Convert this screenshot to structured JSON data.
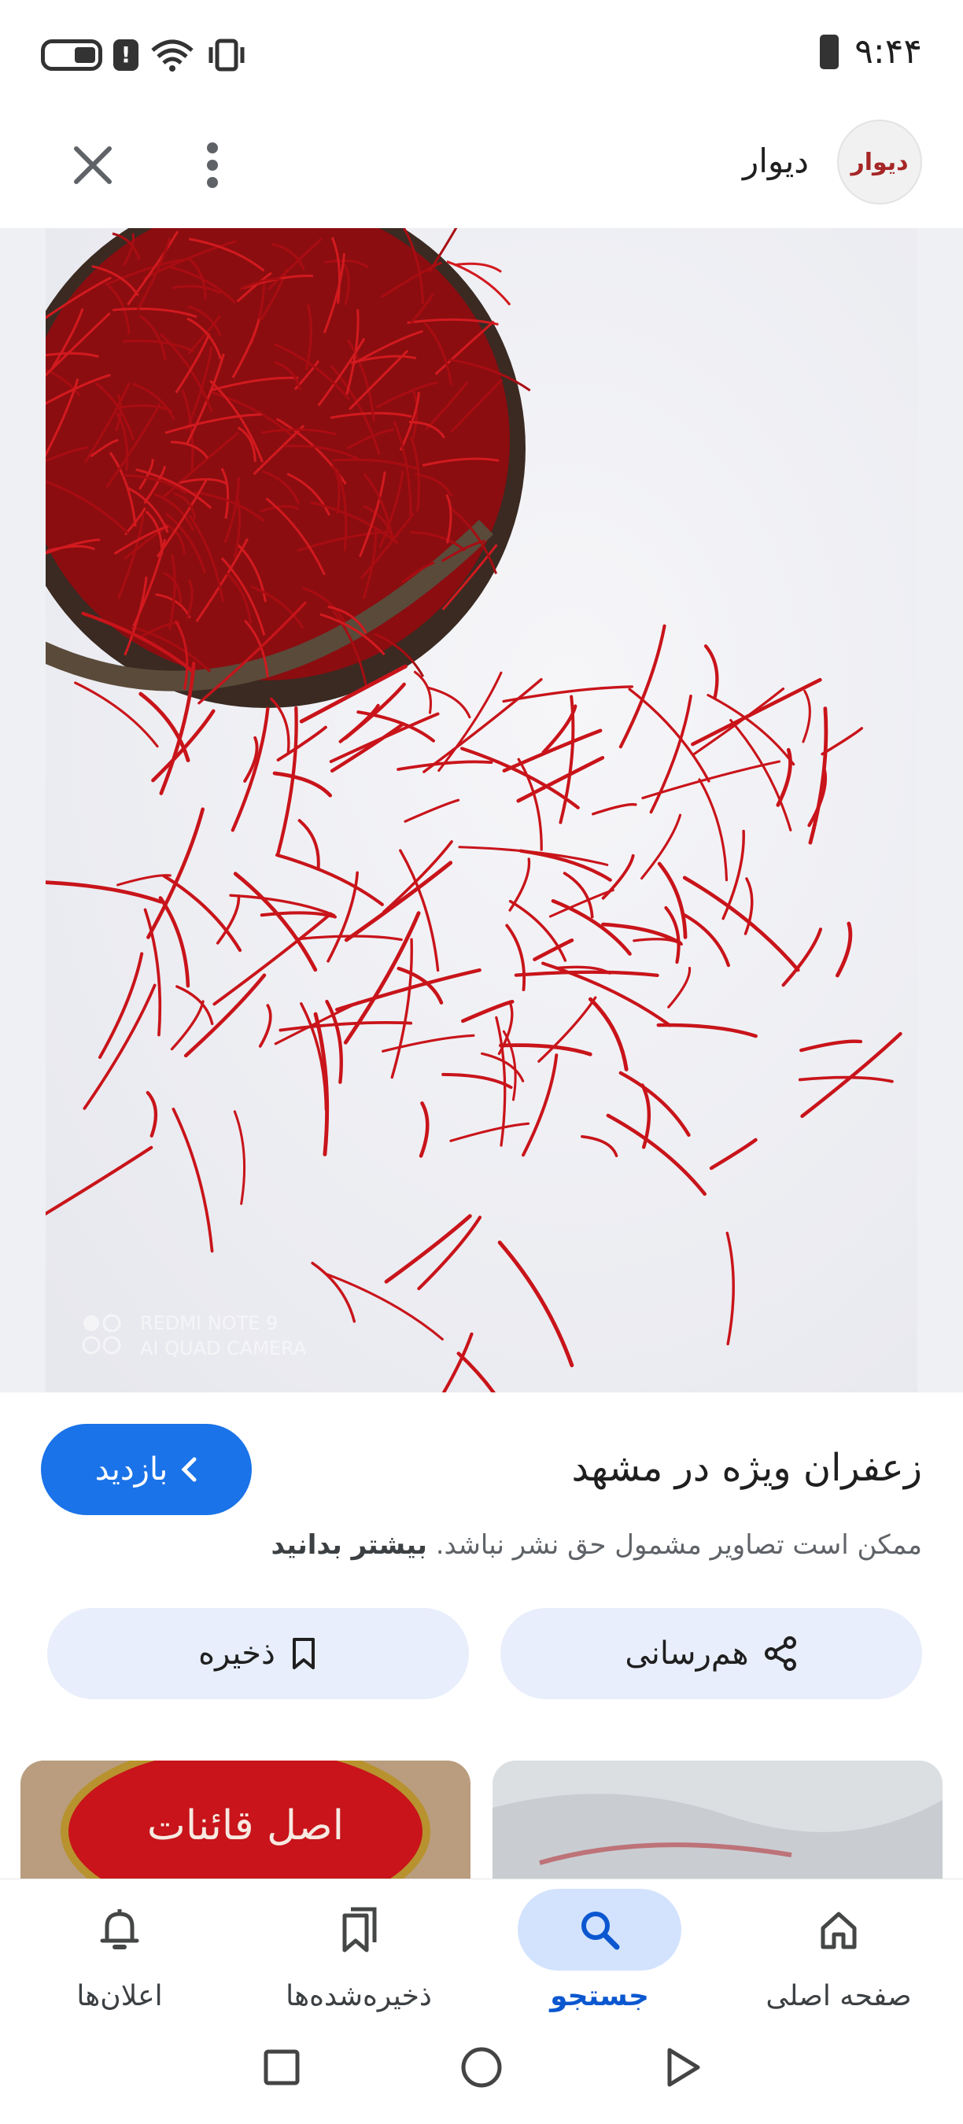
{
  "status_bar": {
    "time": "۹:۴۴",
    "icons": [
      "battery-saver-icon",
      "alert-icon",
      "wifi-icon",
      "vibrate-icon",
      "battery-icon"
    ]
  },
  "app_bar": {
    "site_name": "دیوار",
    "logo_text": "دیوار",
    "icons": [
      "close-icon",
      "more-vert-icon"
    ]
  },
  "image": {
    "watermark_line1": "REDMI NOTE 9",
    "watermark_line2": "AI QUAD CAMERA"
  },
  "info": {
    "title": "زعفران ویژه در مشهد",
    "visit_label": "بازدید",
    "disclaimer": "ممکن است تصاویر مشمول حق نشر نباشد.",
    "learn_more": "بیشتر بدانید",
    "share_label": "هم‌رسانی",
    "save_label": "ذخیره"
  },
  "thumbnails": [
    {
      "label_text": "اصل قائنات"
    },
    {
      "label_text": ""
    }
  ],
  "bottom_nav": {
    "items": [
      {
        "label": "صفحه اصلی",
        "icon": "home-icon",
        "active": false
      },
      {
        "label": "جستجو",
        "icon": "search-icon",
        "active": true
      },
      {
        "label": "ذخیره‌شده‌ها",
        "icon": "bookmarks-icon",
        "active": false
      },
      {
        "label": "اعلان‌ها",
        "icon": "bell-icon",
        "active": false
      }
    ]
  },
  "colors": {
    "accent": "#1a73e8",
    "pill_bg": "#e8eefb",
    "active_nav_bg": "#d3e3fd",
    "saffron": "#c8141a"
  }
}
